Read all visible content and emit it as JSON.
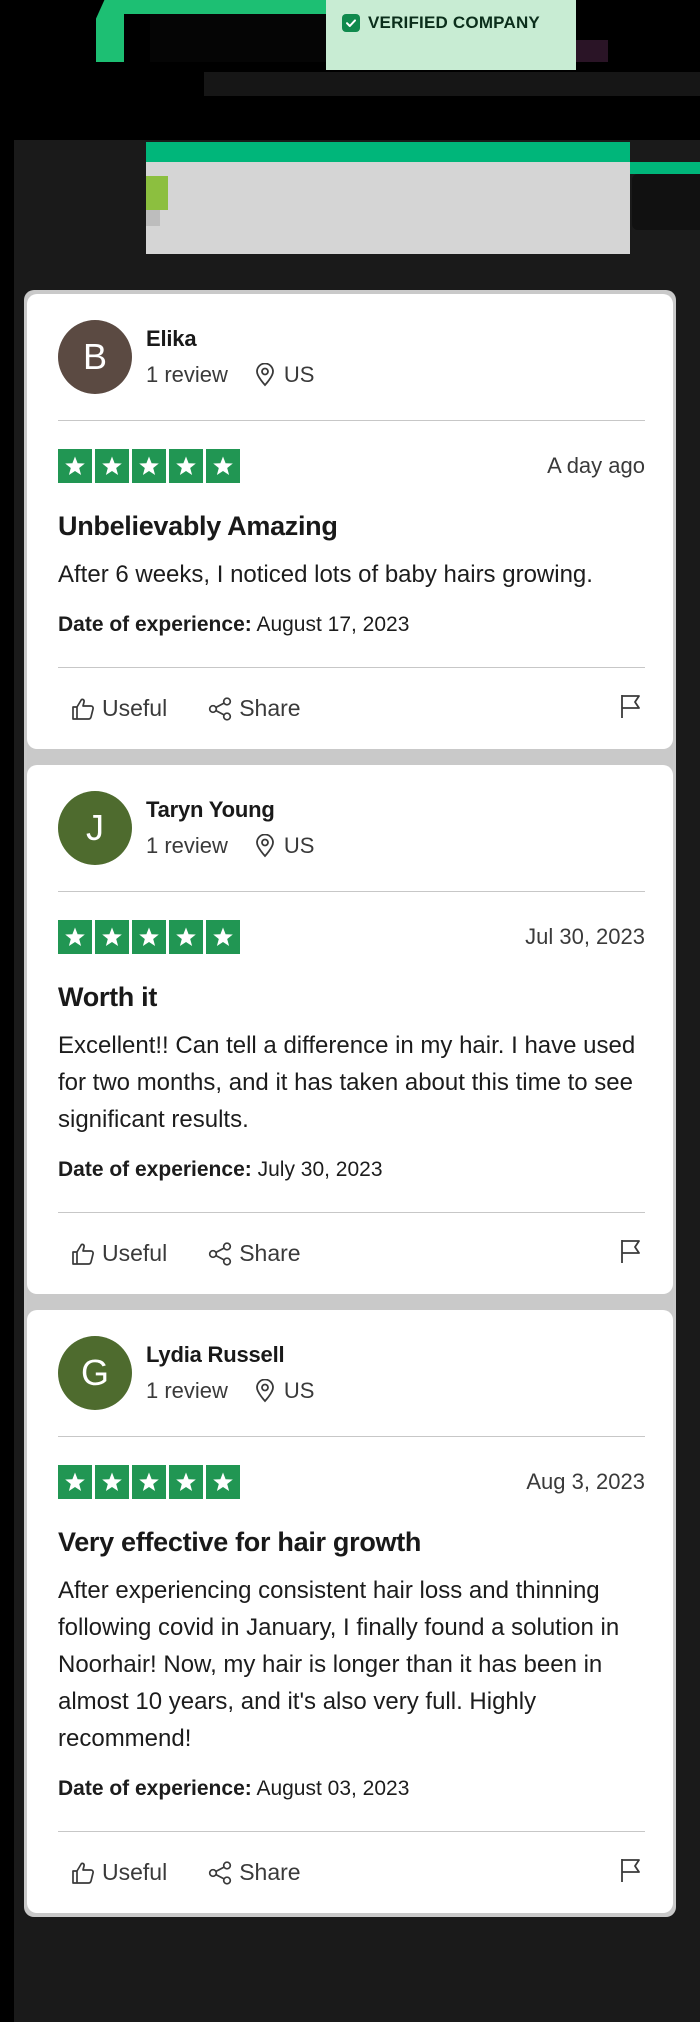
{
  "header": {
    "badge_label": "VERIFIED COMPANY",
    "badge_icon": "shield-check-icon",
    "colors": {
      "brand_green": "#00b67a",
      "badge_bg": "#c8ecd3"
    }
  },
  "reviews": [
    {
      "avatar_letter": "B",
      "avatar_color": "#5b4a42",
      "name": "Elika",
      "review_count": "1 review",
      "location": "US",
      "stars": 5,
      "date": "A day ago",
      "title": "Unbelievably Amazing",
      "body": "After 6 weeks, I noticed lots of baby hairs growing.",
      "experience_label": "Date of experience:",
      "experience_date": "August 17, 2023",
      "useful_label": "Useful",
      "share_label": "Share"
    },
    {
      "avatar_letter": "J",
      "avatar_color": "#4e6b2e",
      "name": "Taryn Young",
      "review_count": "1 review",
      "location": "US",
      "stars": 5,
      "date": "Jul 30, 2023",
      "title": "Worth it",
      "body": "Excellent!! Can tell a difference in my hair. I have used for two months, and it has taken about this time to see significant results.",
      "experience_label": "Date of experience:",
      "experience_date": "July 30, 2023",
      "useful_label": "Useful",
      "share_label": "Share"
    },
    {
      "avatar_letter": "G",
      "avatar_color": "#4e6b2e",
      "name": "Lydia Russell",
      "review_count": "1 review",
      "location": "US",
      "stars": 5,
      "date": "Aug 3, 2023",
      "title": "Very effective for hair growth",
      "body": "After experiencing consistent hair loss and thinning following covid in January, I finally found a solution in Noorhair! Now, my hair is longer than it has been in almost 10 years, and it's also very full. Highly recommend!",
      "experience_label": "Date of experience:",
      "experience_date": "August 03, 2023",
      "useful_label": "Useful",
      "share_label": "Share"
    }
  ],
  "colors": {
    "star_green": "#219653",
    "divider": "#c7c7c7"
  }
}
